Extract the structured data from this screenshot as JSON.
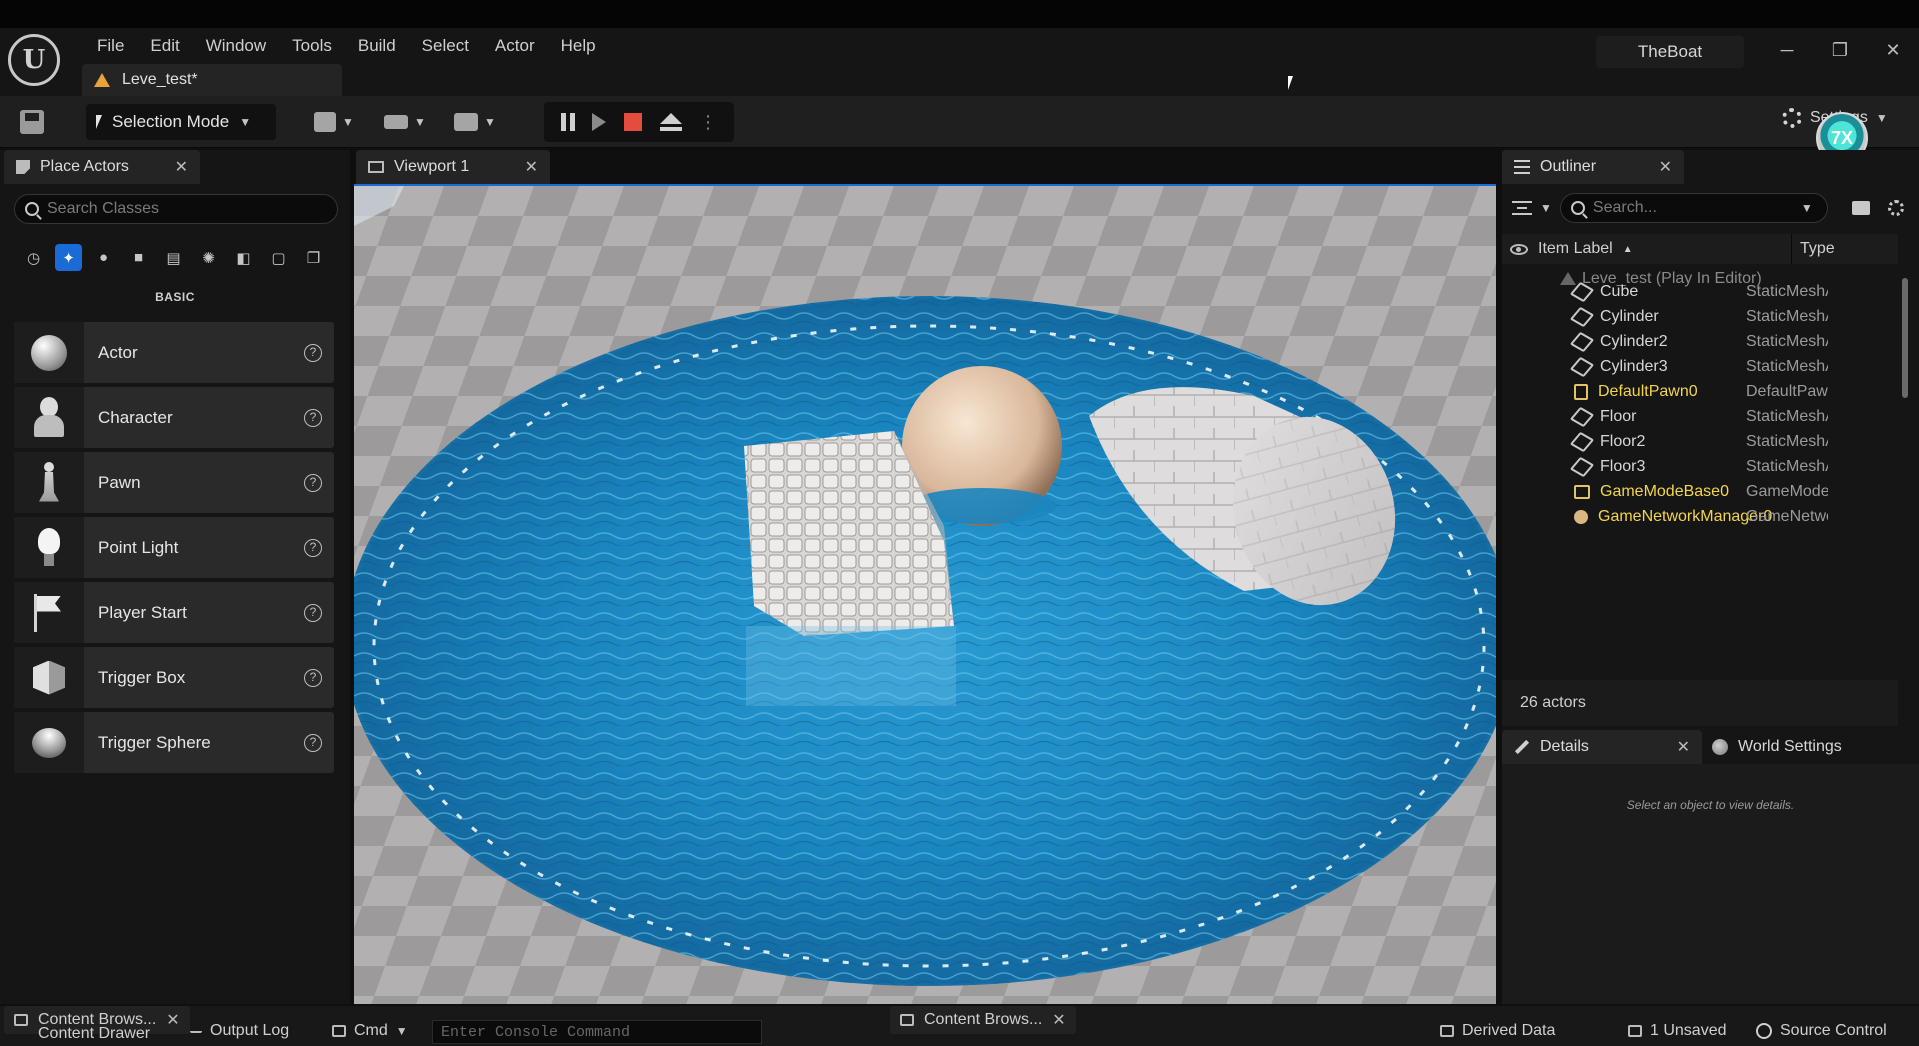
{
  "app": {
    "logo_text": "U",
    "menu": [
      "File",
      "Edit",
      "Window",
      "Tools",
      "Build",
      "Select",
      "Actor",
      "Help"
    ],
    "document_tab": "Leve_test*",
    "project_name": "TheBoat",
    "window_controls": {
      "minimize": "─",
      "restore": "❐",
      "close": "✕"
    }
  },
  "toolbar": {
    "selection_mode": "Selection Mode",
    "settings_label": "Settings",
    "avatar_text": "7X"
  },
  "place_actors": {
    "tab_label": "Place Actors",
    "search_placeholder": "Search Classes",
    "category_label": "BASIC",
    "categories": [
      "recent-icon",
      "basic-icon",
      "lights-icon",
      "shapes-icon",
      "cinematic-icon",
      "visual-effects-icon",
      "volumes-icon",
      "geometry-icon",
      "all-classes-icon"
    ],
    "items": [
      {
        "label": "Actor",
        "icon": "sphere-icon"
      },
      {
        "label": "Character",
        "icon": "character-icon"
      },
      {
        "label": "Pawn",
        "icon": "pawn-icon"
      },
      {
        "label": "Point Light",
        "icon": "bulb-icon"
      },
      {
        "label": "Player Start",
        "icon": "flag-icon"
      },
      {
        "label": "Trigger Box",
        "icon": "box-icon"
      },
      {
        "label": "Trigger Sphere",
        "icon": "sphere-icon"
      }
    ]
  },
  "viewport": {
    "tab_label": "Viewport 1"
  },
  "outliner": {
    "tab_label": "Outliner",
    "search_placeholder": "Search...",
    "col_label": "Item Label",
    "col_type": "Type",
    "root": "Leve_test (Play In Editor)",
    "rows": [
      {
        "label": "Cube",
        "type": "StaticMeshA",
        "icon": "mesh"
      },
      {
        "label": "Cylinder",
        "type": "StaticMeshA",
        "icon": "mesh"
      },
      {
        "label": "Cylinder2",
        "type": "StaticMeshA",
        "icon": "mesh"
      },
      {
        "label": "Cylinder3",
        "type": "StaticMeshA",
        "icon": "mesh"
      },
      {
        "label": "DefaultPawn0",
        "type": "DefaultPawr",
        "icon": "pawn"
      },
      {
        "label": "Floor",
        "type": "StaticMeshA",
        "icon": "mesh"
      },
      {
        "label": "Floor2",
        "type": "StaticMeshA",
        "icon": "mesh"
      },
      {
        "label": "Floor3",
        "type": "StaticMeshA",
        "icon": "mesh"
      },
      {
        "label": "GameModeBase0",
        "type": "GameModeE",
        "icon": "image"
      },
      {
        "label": "GameNetworkManager0",
        "type": "GameNetwo",
        "icon": "ball"
      }
    ],
    "actor_count": "26 actors"
  },
  "details": {
    "tab_label": "Details",
    "world_settings_label": "World Settings",
    "empty_message": "Select an object to view details."
  },
  "statusbar": {
    "content_drawer": "Content Drawer",
    "content_browser_tab_1": "Content Brows...",
    "output_log": "Output Log",
    "cmd": "Cmd",
    "console_placeholder": "Enter Console Command",
    "content_browser_tab_2": "Content Brows...",
    "derived_data": "Derived Data",
    "unsaved": "1 Unsaved",
    "source_control": "Source Control"
  },
  "colors": {
    "accent_blue": "#1b6bd6",
    "stop_red": "#e44c3d",
    "warning_orange": "#e8a33b",
    "highlight_yellow": "#f2d54c",
    "water": "#1e8cc4"
  }
}
